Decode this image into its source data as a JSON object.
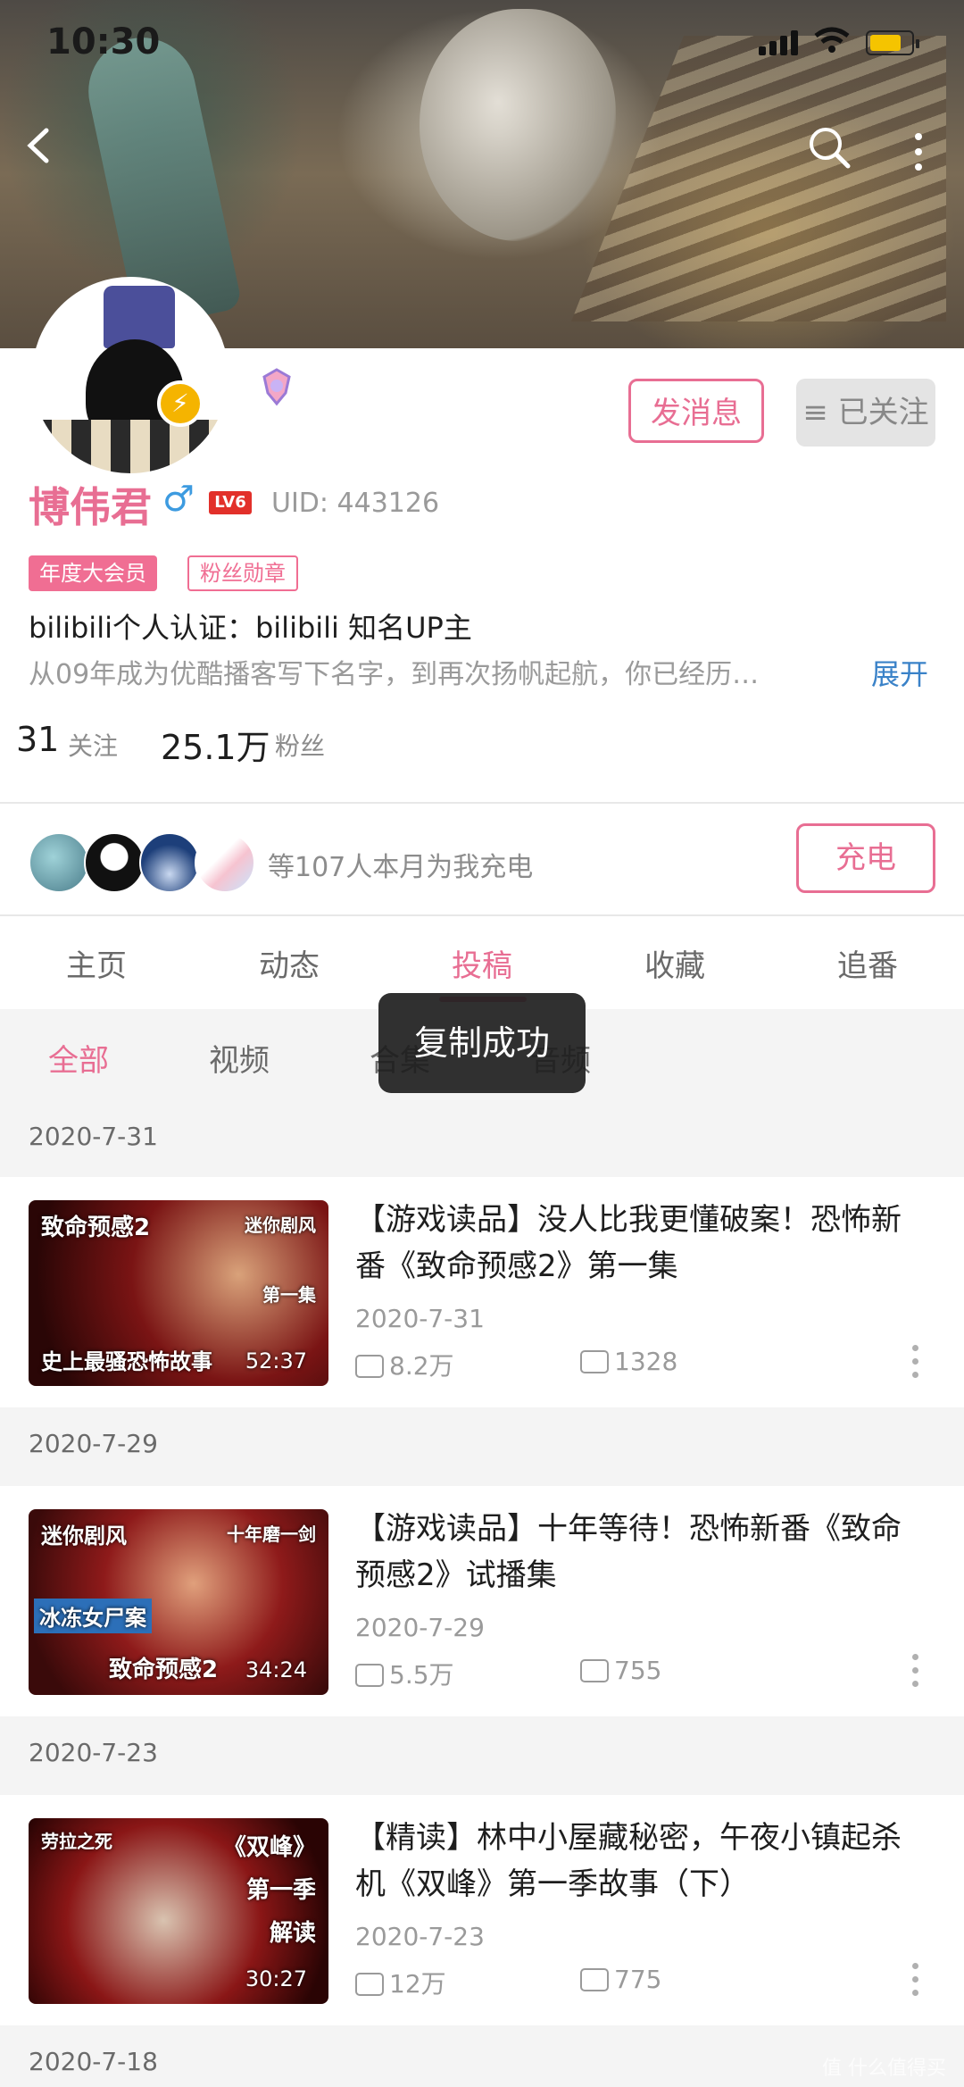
{
  "status_bar": {
    "time": "10:30"
  },
  "header": {
    "back": "‹",
    "search": "⌕",
    "more": "⋮"
  },
  "profile": {
    "name": "博伟君",
    "gender_symbol": "♂",
    "level": "LV6",
    "uid": "UID:  443126",
    "tags": [
      "年度大会员",
      "粉丝勋章"
    ],
    "certification": "bilibili个人认证：bilibili  知名UP主",
    "bio": "从09年成为优酷播客写下名字，到再次扬帆起航，你已经历…",
    "expand_label": "展开",
    "message_button": "发消息",
    "follow_button": "≡ 已关注",
    "following_count": "31",
    "following_label": "关注",
    "followers_count": "25.1万",
    "followers_label": "粉丝"
  },
  "charge": {
    "text": "等107人本月为我充电",
    "button": "充电"
  },
  "tabs": [
    "主页",
    "动态",
    "投稿",
    "收藏",
    "追番"
  ],
  "active_tab": "投稿",
  "subtabs": [
    "全部",
    "视频",
    "合集",
    "音频"
  ],
  "toast": "复制成功",
  "videos": [
    {
      "group_date": "2020-7-31",
      "title": "【游戏读品】没人比我更懂破案！恐怖新番《致命预感2》第一集",
      "date": "2020-7-31",
      "plays": "8.2万",
      "danmaku": "1328",
      "duration": "52:37",
      "thumb_top": "致命预感2",
      "thumb_corner": "迷你剧风",
      "thumb_mid": "第一集",
      "thumb_bottom": "史上最骚恐怖故事"
    },
    {
      "group_date": "2020-7-29",
      "title": "【游戏读品】十年等待！恐怖新番《致命预感2》试播集",
      "date": "2020-7-29",
      "plays": "5.5万",
      "danmaku": "755",
      "duration": "34:24",
      "thumb_top": "迷你剧风",
      "thumb_corner": "十年磨一剑",
      "thumb_mid": "冰冻女尸案",
      "thumb_bottom": "致命预感2"
    },
    {
      "group_date": "2020-7-23",
      "title": "【精读】林中小屋藏秘密，午夜小镇起杀机《双峰》第一季故事（下）",
      "date": "2020-7-23",
      "plays": "12万",
      "danmaku": "775",
      "duration": "30:27",
      "thumb_top": "劳拉之死",
      "thumb_corner": "《双峰》",
      "thumb_mid": "第一季",
      "thumb_bottom": "解读"
    }
  ],
  "next_group_date": "2020-7-18",
  "watermark": "值 什么值得买"
}
